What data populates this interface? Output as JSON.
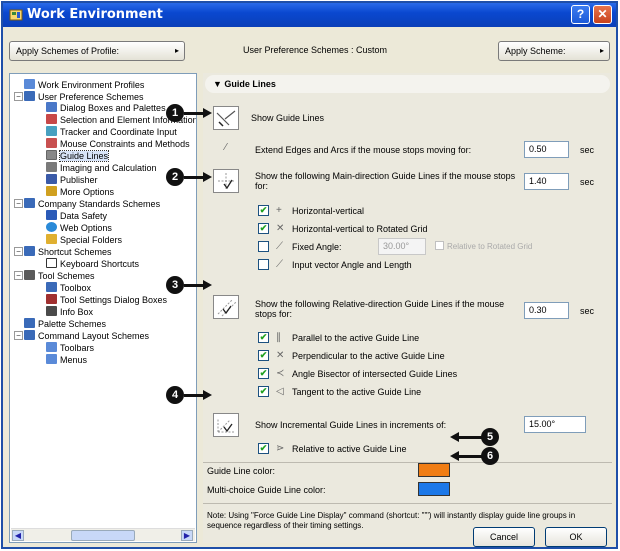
{
  "window": {
    "title": "Work Environment",
    "help_label": "?",
    "close_label": "✕"
  },
  "top": {
    "apply_profile_label": "Apply Schemes of Profile:",
    "user_pref_label": "User Preference Schemes : Custom",
    "apply_scheme_label": "Apply Scheme:"
  },
  "tree": {
    "root": "Work Environment Profiles",
    "user_pref": "User Preference Schemes",
    "items_user": [
      "Dialog Boxes and Palettes",
      "Selection and Element Information",
      "Tracker and Coordinate Input",
      "Mouse Constraints and Methods",
      "Guide Lines",
      "Imaging and Calculation",
      "Publisher",
      "More Options"
    ],
    "company": "Company Standards Schemes",
    "items_company": [
      "Data Safety",
      "Web Options",
      "Special Folders"
    ],
    "shortcut": "Shortcut Schemes",
    "items_shortcut": [
      "Keyboard Shortcuts"
    ],
    "tool": "Tool Schemes",
    "items_tool": [
      "Toolbox",
      "Tool Settings Dialog Boxes",
      "Info Box"
    ],
    "palette": "Palette Schemes",
    "command": "Command Layout Schemes",
    "items_command": [
      "Toolbars",
      "Menus"
    ]
  },
  "panel": {
    "section_title": "Guide Lines",
    "show_guide_lines": "Show Guide Lines",
    "extend_edges": "Extend Edges and Arcs if the mouse stops moving for:",
    "extend_value": "0.50",
    "sec": "sec",
    "main_dir_1": "Show the following Main-direction Guide Lines if the mouse stops",
    "main_dir_2": "for:",
    "main_dir_value": "1.40",
    "main_opts": [
      {
        "label": "Horizontal-vertical",
        "checked": "✔"
      },
      {
        "label": "Horizontal-vertical to Rotated Grid",
        "checked": "✔"
      },
      {
        "label": "Fixed Angle:",
        "checked": ""
      },
      {
        "label": "Input vector Angle and Length",
        "checked": ""
      }
    ],
    "fixed_angle_value": "30.00°",
    "relative_to_rotated_grid": "Relative to Rotated Grid",
    "rel_dir_1": "Show the following Relative-direction Guide Lines if the mouse",
    "rel_dir_2": "stops for:",
    "rel_dir_value": "0.30",
    "rel_opts": [
      {
        "label": "Parallel to the active Guide Line",
        "checked": "✔"
      },
      {
        "label": "Perpendicular to the active Guide Line",
        "checked": "✔"
      },
      {
        "label": "Angle Bisector of intersected Guide Lines",
        "checked": "✔"
      },
      {
        "label": "Tangent to the active Guide Line",
        "checked": "✔"
      }
    ],
    "incremental": "Show Incremental Guide Lines in increments of:",
    "incremental_value": "15.00°",
    "relative_active": "Relative to active Guide Line",
    "relative_active_checked": "✔",
    "guide_color_label": "Guide Line color:",
    "multi_color_label": "Multi-choice Guide Line color:",
    "guide_color": "#f07d14",
    "multi_color": "#1c78e8",
    "note": "Note: Using \"Force Guide Line Display\" command (shortcut: \"'\") will instantly display guide line groups in sequence regardless of their timing settings.",
    "cancel_label": "Cancel",
    "ok_label": "OK"
  },
  "callouts": [
    "1",
    "2",
    "3",
    "4",
    "5",
    "6"
  ]
}
